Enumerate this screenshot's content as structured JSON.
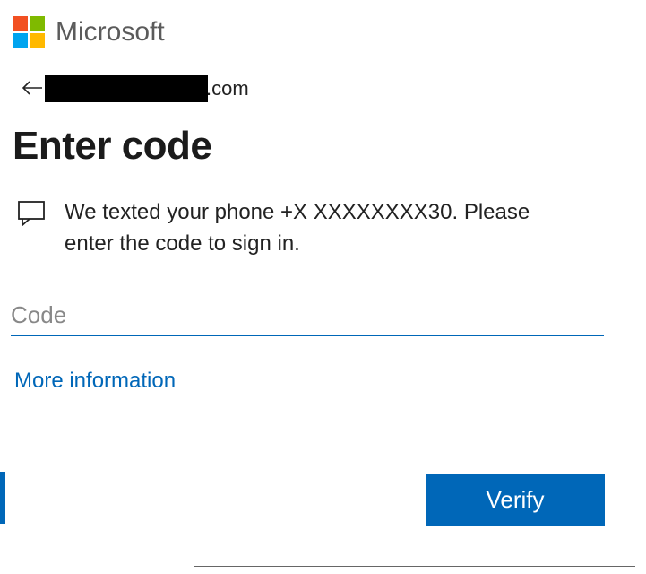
{
  "brand": {
    "name": "Microsoft"
  },
  "account": {
    "email_suffix": ".com"
  },
  "page": {
    "title": "Enter code",
    "info_text": "We texted your phone +X XXXXXXXX30. Please enter the code to sign in."
  },
  "input": {
    "placeholder": "Code",
    "value": ""
  },
  "links": {
    "more_info": "More information"
  },
  "buttons": {
    "verify": "Verify"
  }
}
